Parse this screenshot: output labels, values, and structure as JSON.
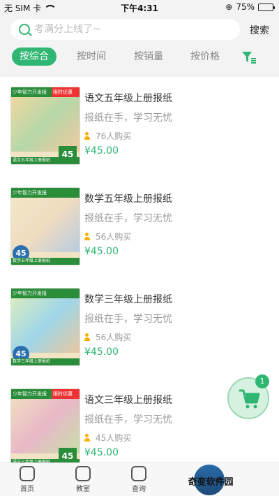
{
  "status": {
    "carrier": "无 SIM 卡",
    "time": "下午4:31",
    "battery": "75%",
    "battery_level": 0.75
  },
  "search": {
    "placeholder": "考满分上线了~",
    "button": "搜索"
  },
  "tabs": [
    {
      "label": "按综合",
      "active": true
    },
    {
      "label": "按时间",
      "active": false
    },
    {
      "label": "按销量",
      "active": false
    },
    {
      "label": "按价格",
      "active": false
    }
  ],
  "products": [
    {
      "title": "语文五年级上册报纸",
      "subtitle": "报纸在手，学习无忧",
      "buyers": "76人购买",
      "price": "¥45.00",
      "cover_top_left": "少年智力开发报",
      "cover_top_right": "限时优惠",
      "cover_price": "45",
      "cover_foot": "语文五年级上册报纸"
    },
    {
      "title": "数学五年级上册报纸",
      "subtitle": "报纸在手，学习无忧",
      "buyers": "56人购买",
      "price": "¥45.00",
      "cover_top_left": "少年智力开发报",
      "cover_top_right": "",
      "cover_price": "45",
      "cover_foot": "数学五年级上册报纸"
    },
    {
      "title": "数学三年级上册报纸",
      "subtitle": "报纸在手，学习无忧",
      "buyers": "56人购买",
      "price": "¥45.00",
      "cover_top_left": "少年智力开发报",
      "cover_top_right": "",
      "cover_price": "45",
      "cover_foot": "数学三年级上册报纸"
    },
    {
      "title": "语文三年级上册报纸",
      "subtitle": "报纸在手，学习无忧",
      "buyers": "45人购买",
      "price": "¥45.00",
      "cover_top_left": "少年智力开发报",
      "cover_top_right": "限时优惠",
      "cover_price": "45",
      "cover_foot": "语文三年级上册报纸"
    }
  ],
  "cart": {
    "count": "1"
  },
  "tabbar": [
    {
      "label": "首页",
      "icon": "home-icon"
    },
    {
      "label": "教室",
      "icon": "classroom-icon"
    },
    {
      "label": "查询",
      "icon": "query-icon"
    }
  ],
  "watermark": {
    "text": "奇变软件园"
  },
  "colors": {
    "accent": "#2fb673",
    "price": "#2fb673"
  }
}
